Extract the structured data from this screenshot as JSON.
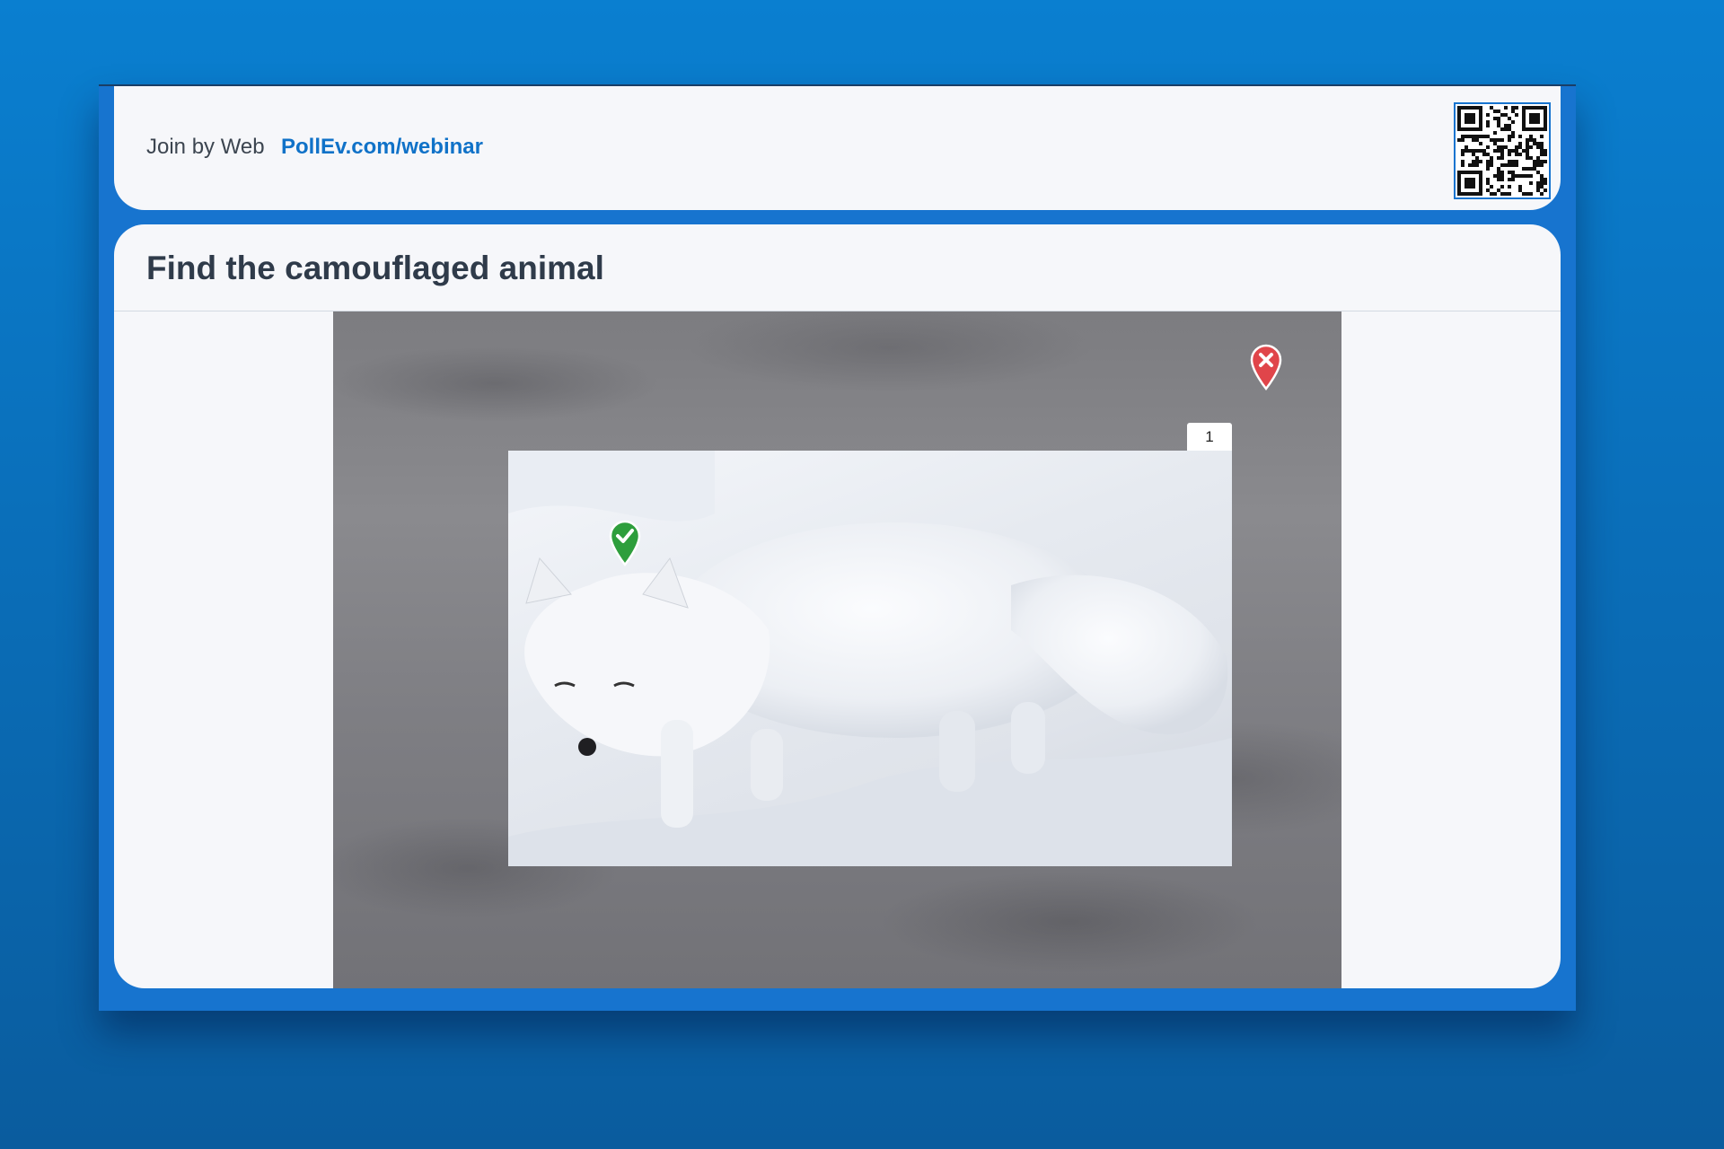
{
  "join": {
    "label": "Join by Web",
    "url": "PollEv.com/webinar"
  },
  "question": {
    "title": "Find the camouflaged animal"
  },
  "image": {
    "subject": "arctic fox in snow"
  },
  "answer_region": {
    "label": "1"
  },
  "responses": [
    {
      "status": "correct",
      "icon": "check-icon",
      "color": "#2e9e3c"
    },
    {
      "status": "incorrect",
      "icon": "close-icon",
      "color": "#e0454a"
    }
  ],
  "colors": {
    "background": "#0a6fba",
    "accent": "#1072c8",
    "card": "#f6f7fa"
  }
}
